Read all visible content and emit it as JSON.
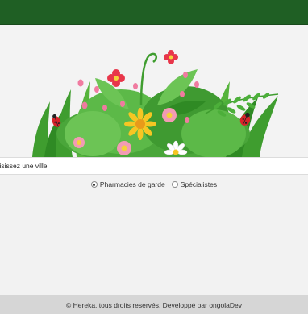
{
  "header": {
    "bar_color": "#1f5f24"
  },
  "hero": {
    "image": "flowers-and-ladybugs-illustration"
  },
  "search": {
    "placeholder": "hoisissez une ville",
    "value": ""
  },
  "filter": {
    "options": [
      {
        "label": "Pharmacies de garde",
        "selected": true
      },
      {
        "label": "Spécialistes",
        "selected": false
      }
    ]
  },
  "footer": {
    "text": "© Hereka, tous droits reservés. Developpé par ongolaDev"
  }
}
